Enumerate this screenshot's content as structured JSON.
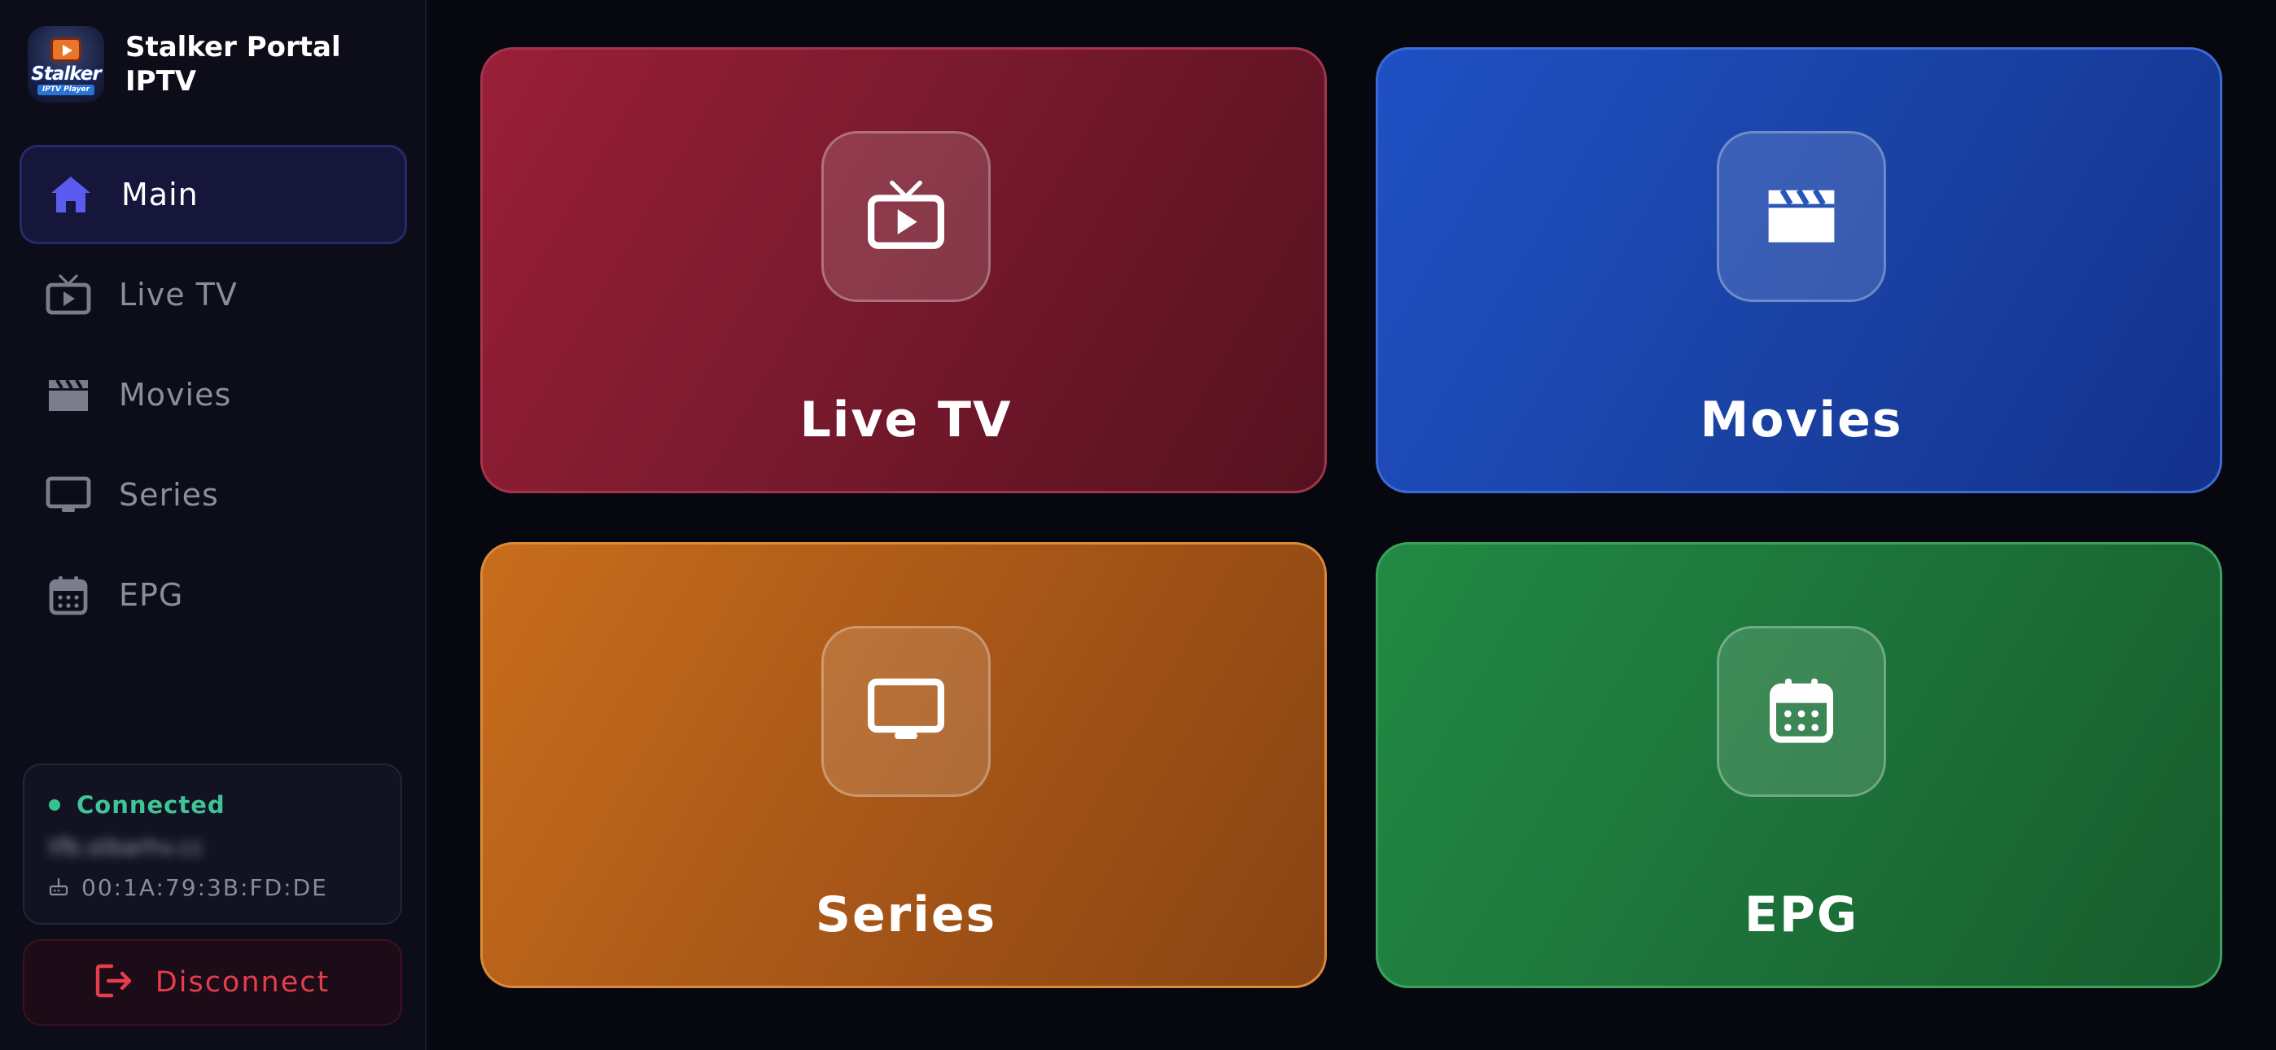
{
  "brand": {
    "name": "Stalker Portal IPTV",
    "logo_word": "Stalker",
    "logo_sub": "IPTV Player"
  },
  "sidebar": {
    "items": [
      {
        "label": "Main",
        "icon": "home-icon",
        "active": true
      },
      {
        "label": "Live TV",
        "icon": "tv-play-icon",
        "active": false
      },
      {
        "label": "Movies",
        "icon": "clapperboard-icon",
        "active": false
      },
      {
        "label": "Series",
        "icon": "monitor-icon",
        "active": false
      },
      {
        "label": "EPG",
        "icon": "calendar-icon",
        "active": false
      }
    ]
  },
  "status": {
    "state": "Connected",
    "server": "tfb.stbarhv.cc",
    "mac": "00:1A:79:3B:FD:DE"
  },
  "disconnect": {
    "label": "Disconnect"
  },
  "tiles": [
    {
      "label": "Live TV",
      "icon": "tv-play-icon"
    },
    {
      "label": "Movies",
      "icon": "clapperboard-icon"
    },
    {
      "label": "Series",
      "icon": "monitor-icon"
    },
    {
      "label": "EPG",
      "icon": "calendar-icon"
    }
  ],
  "colors": {
    "accent": "#5b5bf0",
    "connected": "#3ec596",
    "danger": "#e53e4a",
    "live_tv": "#8a1c33",
    "movies": "#1a45ae",
    "series": "#b05c18",
    "epg": "#1f7a3e"
  }
}
